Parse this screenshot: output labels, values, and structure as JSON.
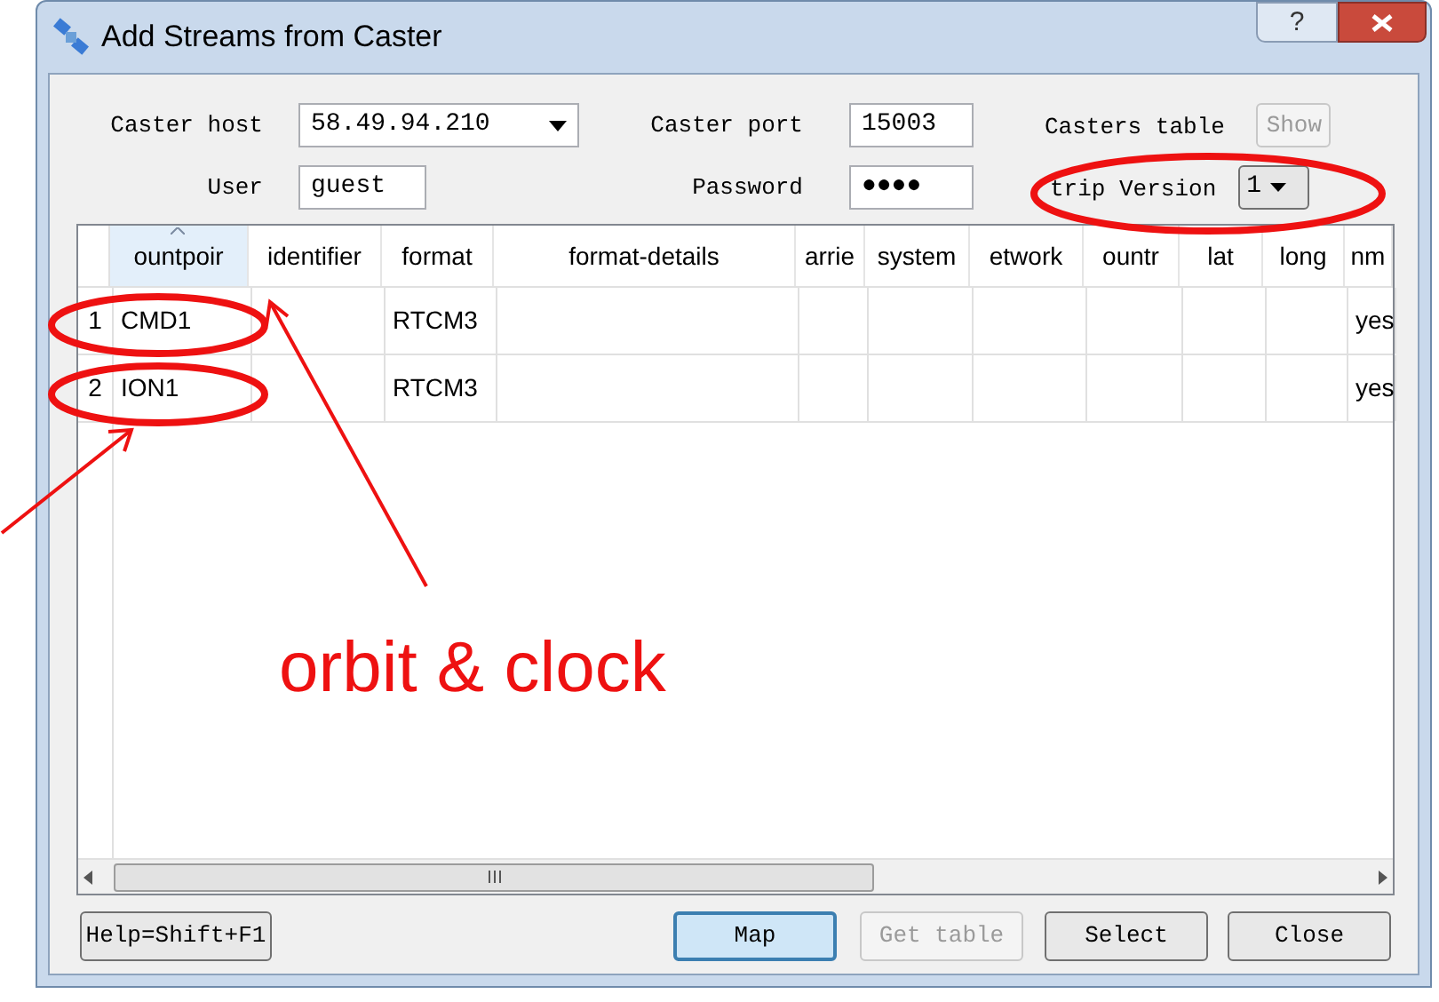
{
  "window": {
    "title": "Add Streams from Caster",
    "help": "?"
  },
  "form": {
    "caster_host": {
      "label": "Caster host",
      "value": "58.49.94.210"
    },
    "caster_port": {
      "label": "Caster port",
      "value": "15003"
    },
    "casters_table": {
      "label": "Casters table",
      "button": {
        "label": "Show",
        "disabled": true
      }
    },
    "user": {
      "label": "User",
      "value": "guest"
    },
    "password": {
      "label": "Password",
      "value": "●●●●"
    },
    "ntrip_version": {
      "label": "trip Version",
      "value": "1"
    }
  },
  "table": {
    "columns": [
      {
        "label": "ountpoir",
        "sorted": true
      },
      {
        "label": "identifier",
        "sorted": false
      },
      {
        "label": "format",
        "sorted": false
      },
      {
        "label": "format-details",
        "sorted": false
      },
      {
        "label": "arrie",
        "sorted": false
      },
      {
        "label": "system",
        "sorted": false
      },
      {
        "label": "etwork",
        "sorted": false
      },
      {
        "label": "ountr",
        "sorted": false
      },
      {
        "label": "lat",
        "sorted": false
      },
      {
        "label": "long",
        "sorted": false
      },
      {
        "label": "nm",
        "sorted": false
      }
    ],
    "rows": [
      {
        "number": "1",
        "cells": [
          "CMD1",
          null,
          "RTCM3",
          null,
          null,
          null,
          null,
          null,
          null,
          null,
          "yes"
        ]
      },
      {
        "number": "2",
        "cells": [
          "ION1",
          null,
          "RTCM3",
          null,
          null,
          null,
          null,
          null,
          null,
          null,
          "yes"
        ]
      }
    ]
  },
  "buttons": [
    {
      "label": "Help=Shift+F1",
      "disabled": false,
      "default": false
    },
    {
      "label": "Map",
      "disabled": false,
      "default": true
    },
    {
      "label": "Get table",
      "disabled": true,
      "default": false
    },
    {
      "label": "Select",
      "disabled": false,
      "default": false
    },
    {
      "label": "Close",
      "disabled": false,
      "default": false
    }
  ],
  "annotation": {
    "text": "orbit & clock"
  }
}
